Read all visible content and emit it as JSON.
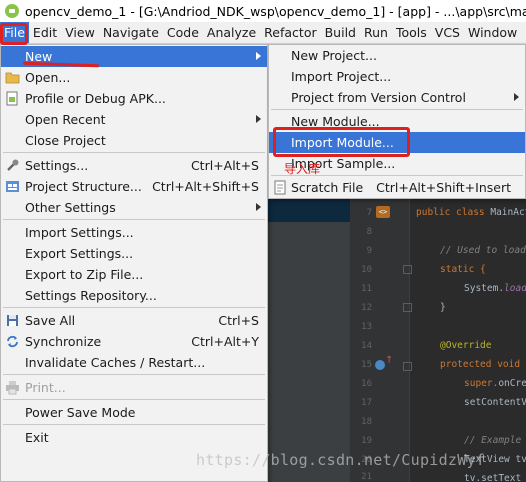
{
  "window": {
    "title": "opencv_demo_1 - [G:\\Andriod_NDK_wsp\\opencv_demo_1] - [app] - ...\\app\\src\\main\\java"
  },
  "menubar": [
    "File",
    "Edit",
    "View",
    "Navigate",
    "Code",
    "Analyze",
    "Refactor",
    "Build",
    "Run",
    "Tools",
    "VCS",
    "Window"
  ],
  "file_menu": {
    "new": "New",
    "open": "Open...",
    "profile": "Profile or Debug APK...",
    "open_recent": "Open Recent",
    "close_project": "Close Project",
    "settings": "Settings...",
    "settings_sc": "Ctrl+Alt+S",
    "project_structure": "Project Structure...",
    "project_structure_sc": "Ctrl+Alt+Shift+S",
    "other_settings": "Other Settings",
    "import_settings": "Import Settings...",
    "export_settings": "Export Settings...",
    "export_zip": "Export to Zip File...",
    "settings_repo": "Settings Repository...",
    "save_all": "Save All",
    "save_all_sc": "Ctrl+S",
    "synchronize": "Synchronize",
    "synchronize_sc": "Ctrl+Alt+Y",
    "invalidate": "Invalidate Caches / Restart...",
    "print": "Print...",
    "power_save": "Power Save Mode",
    "exit": "Exit"
  },
  "new_submenu": {
    "new_project": "New Project...",
    "import_project": "Import Project...",
    "project_vcs": "Project from Version Control",
    "new_module": "New Module...",
    "import_module": "Import Module...",
    "import_sample": "Import Sample...",
    "scratch_file": "Scratch File",
    "scratch_file_sc": "Ctrl+Alt+Shift+Insert"
  },
  "annotation": "导入库",
  "editor": {
    "line_numbers": [
      "7",
      "8",
      "9",
      "10",
      "11",
      "12",
      "13",
      "14",
      "15",
      "16",
      "17",
      "18",
      "19",
      "20",
      "21"
    ],
    "l7_kw": "public class",
    "l7_rest": " MainAct",
    "l9": "// Used to load",
    "l10": "static {",
    "l11_a": "System.",
    "l11_b": "load",
    "l12": "}",
    "l14": "@Override",
    "l15_kw": "protected void",
    "l16_a": "super.",
    "l16_b": "onCre",
    "l17": "setContentV",
    "l19": "// Example",
    "l20": "TextView tv",
    "l21": "tv.setText"
  },
  "watermark": "https://blog.csdn.net/CupidzWyf"
}
